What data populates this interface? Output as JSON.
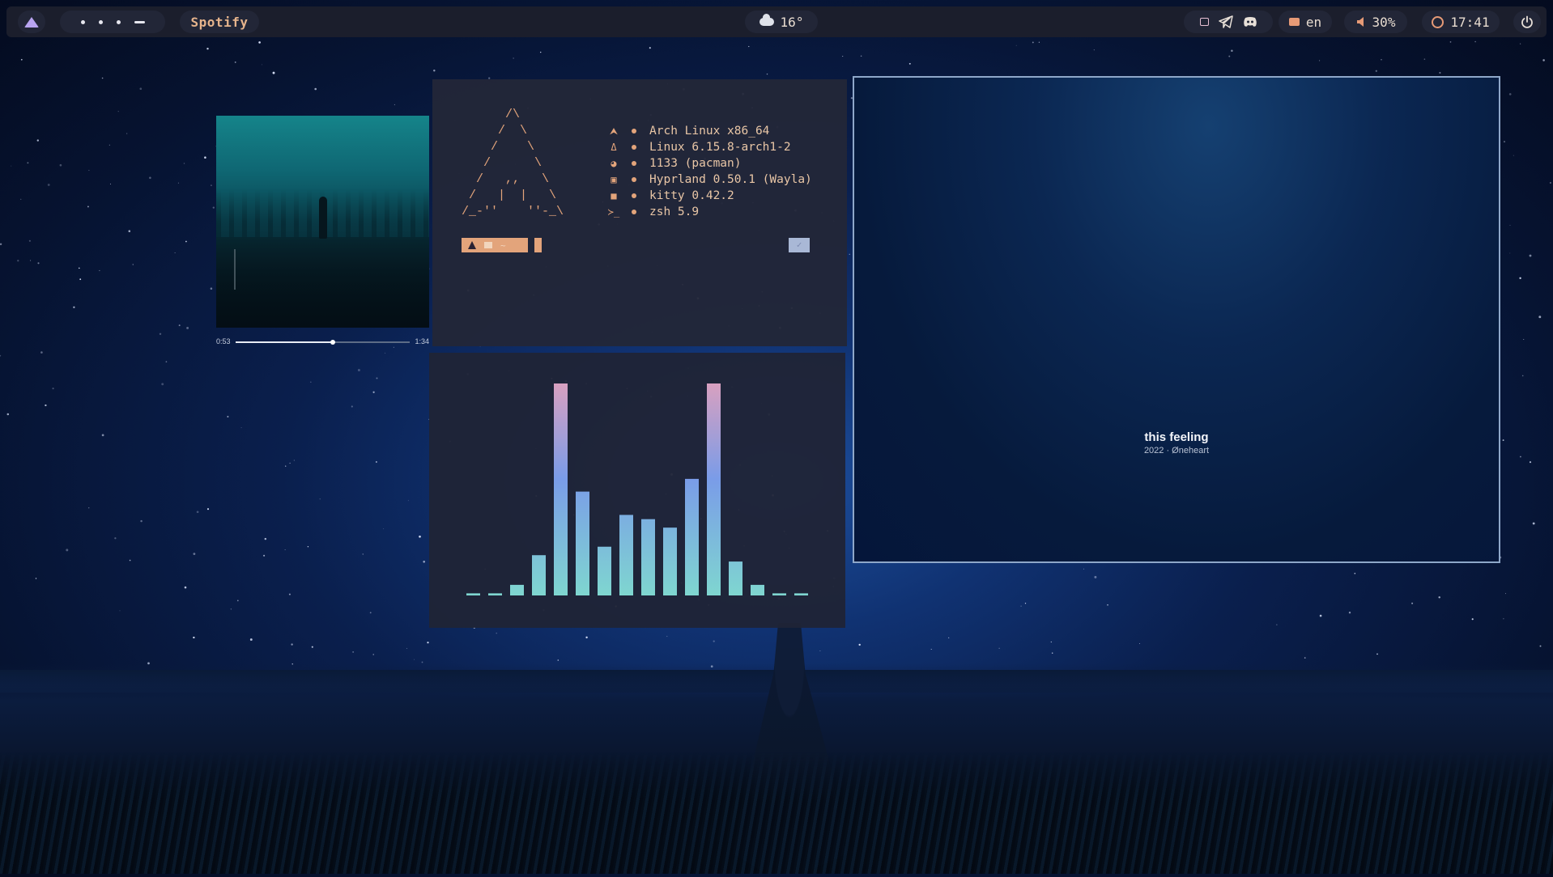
{
  "topbar": {
    "launcher_icon": "arch-triangle-icon",
    "workspaces": [
      "1",
      "2",
      "3",
      "4"
    ],
    "active_workspace": 4,
    "active_app": "Spotify",
    "weather": {
      "icon": "cloud-icon",
      "temp": "16°"
    },
    "tray_icons": [
      "window-icon",
      "telegram-icon",
      "discord-icon"
    ],
    "language": "en",
    "volume": "30%",
    "clock": "17:41",
    "power_icon": "power-icon"
  },
  "fetch": {
    "ascii": "      /\\\n     /  \\\n    /    \\\n   /      \\\n  /   ,,   \\\n /   |  |   \\\n/_-''    ''-_\\",
    "rows": [
      {
        "icon": "arch-icon",
        "glyph": "⮝",
        "text": "Arch Linux x86_64"
      },
      {
        "icon": "kernel-icon",
        "glyph": "Δ",
        "text": "Linux 6.15.8-arch1-2"
      },
      {
        "icon": "package-icon",
        "glyph": "◕",
        "text": "1133 (pacman)"
      },
      {
        "icon": "monitor-icon",
        "glyph": "▣",
        "text": "Hyprland 0.50.1 (Wayla)"
      },
      {
        "icon": "terminal-icon",
        "glyph": "■",
        "text": "kitty 0.42.2"
      },
      {
        "icon": "shell-icon",
        "glyph": "≻_",
        "text": "zsh 5.9"
      }
    ],
    "prompt_path": "~",
    "status_check": "✓"
  },
  "visualizer": {
    "values": [
      0.01,
      0.01,
      0.05,
      0.19,
      1.0,
      0.49,
      0.23,
      0.38,
      0.36,
      0.32,
      0.55,
      1.0,
      0.16,
      0.05,
      0.01,
      0.01
    ],
    "colors": {
      "low": "#7fd6d0",
      "mid": "#7a9ce8",
      "high": "#d8a0c0"
    }
  },
  "player": {
    "elapsed": "0:53",
    "duration": "1:34",
    "progress": 0.56,
    "title": "this feeling",
    "subtitle": "2022 · Øneheart"
  }
}
